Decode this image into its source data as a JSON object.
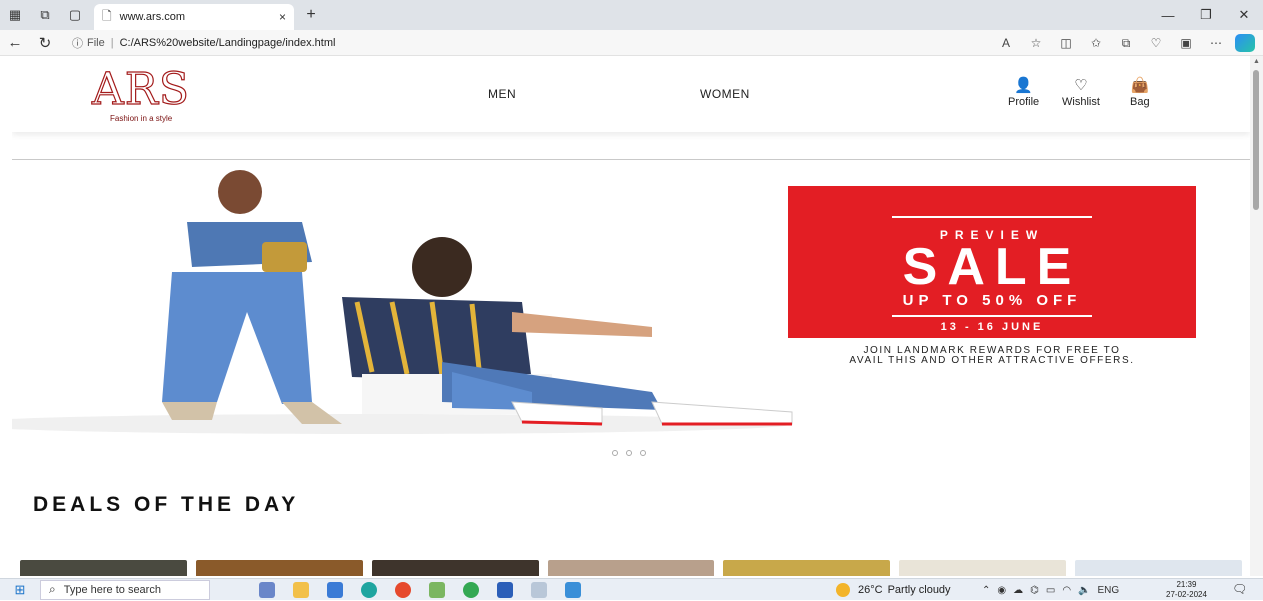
{
  "browser": {
    "tab_title": "www.ars.com",
    "tab_close": "×",
    "new_tab": "+",
    "file_label": "File",
    "url_separator": "|",
    "url": "C:/ARS%20website/Landingpage/index.html",
    "tab_icons": [
      "extensions-icon",
      "workspaces-icon",
      "tab-actions-icon"
    ],
    "toolbar_icons": [
      "read-aloud-icon",
      "favorite-star-icon",
      "split-screen-icon",
      "favorites-icon",
      "collections-icon",
      "browser-essentials-icon",
      "copilot-app-icon",
      "more-icon",
      "copilot-icon"
    ]
  },
  "header": {
    "logo_text": "ARS",
    "logo_tagline": "Fashion in a style",
    "nav": [
      "MEN",
      "WOMEN"
    ],
    "profile_label": "Profile",
    "wishlist_label": "Wishlist",
    "bag_label": "Bag"
  },
  "hero": {
    "preview": "PREVIEW",
    "sale": "SALE",
    "discount": "UP TO 50% OFF",
    "dates": "13 - 16 JUNE",
    "note_line1": "JOIN LANDMARK REWARDS FOR FREE TO",
    "note_line2": "AVAIL THIS AND OTHER ATTRACTIVE OFFERS.",
    "carousel_dots": 3,
    "colors": {
      "promo_bg": "#e31e24"
    }
  },
  "deals": {
    "title": "DEALS OF THE DAY",
    "thumbnail_count": 7
  },
  "taskbar": {
    "search_placeholder": "Type here to search",
    "app_icons": [
      "task-view-icon",
      "file-explorer-icon",
      "store-icon",
      "edge-icon",
      "chrome-icon",
      "paint-icon",
      "chrome-profile-icon",
      "word-icon",
      "notepad-icon",
      "photos-icon"
    ],
    "weather_temp": "26°C",
    "weather_text": "Partly cloudy",
    "language": "ENG",
    "time": "21:39",
    "date": "27-02-2024"
  }
}
